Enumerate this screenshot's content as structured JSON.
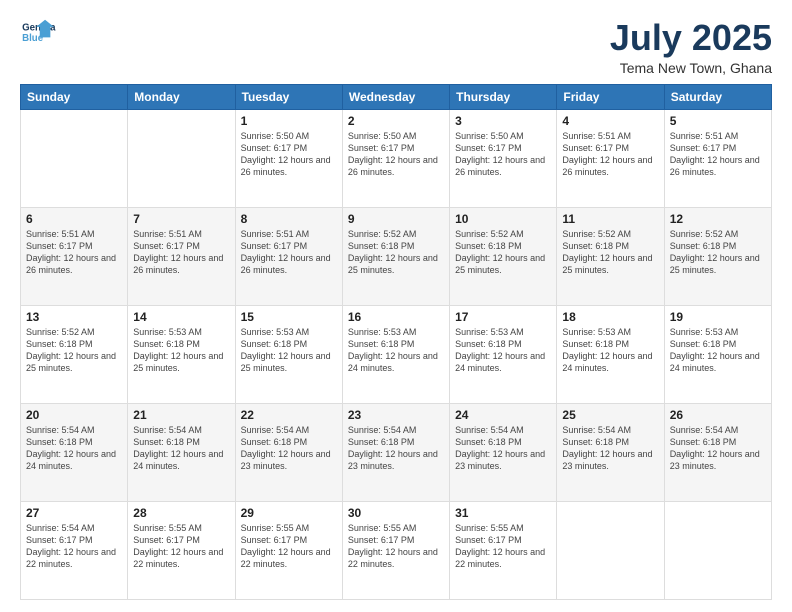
{
  "logo": {
    "line1": "General",
    "line2": "Blue"
  },
  "title": "July 2025",
  "subtitle": "Tema New Town, Ghana",
  "days_header": [
    "Sunday",
    "Monday",
    "Tuesday",
    "Wednesday",
    "Thursday",
    "Friday",
    "Saturday"
  ],
  "weeks": [
    [
      {
        "day": "",
        "info": ""
      },
      {
        "day": "",
        "info": ""
      },
      {
        "day": "1",
        "info": "Sunrise: 5:50 AM\nSunset: 6:17 PM\nDaylight: 12 hours\nand 26 minutes."
      },
      {
        "day": "2",
        "info": "Sunrise: 5:50 AM\nSunset: 6:17 PM\nDaylight: 12 hours\nand 26 minutes."
      },
      {
        "day": "3",
        "info": "Sunrise: 5:50 AM\nSunset: 6:17 PM\nDaylight: 12 hours\nand 26 minutes."
      },
      {
        "day": "4",
        "info": "Sunrise: 5:51 AM\nSunset: 6:17 PM\nDaylight: 12 hours\nand 26 minutes."
      },
      {
        "day": "5",
        "info": "Sunrise: 5:51 AM\nSunset: 6:17 PM\nDaylight: 12 hours\nand 26 minutes."
      }
    ],
    [
      {
        "day": "6",
        "info": "Sunrise: 5:51 AM\nSunset: 6:17 PM\nDaylight: 12 hours\nand 26 minutes."
      },
      {
        "day": "7",
        "info": "Sunrise: 5:51 AM\nSunset: 6:17 PM\nDaylight: 12 hours\nand 26 minutes."
      },
      {
        "day": "8",
        "info": "Sunrise: 5:51 AM\nSunset: 6:17 PM\nDaylight: 12 hours\nand 26 minutes."
      },
      {
        "day": "9",
        "info": "Sunrise: 5:52 AM\nSunset: 6:18 PM\nDaylight: 12 hours\nand 25 minutes."
      },
      {
        "day": "10",
        "info": "Sunrise: 5:52 AM\nSunset: 6:18 PM\nDaylight: 12 hours\nand 25 minutes."
      },
      {
        "day": "11",
        "info": "Sunrise: 5:52 AM\nSunset: 6:18 PM\nDaylight: 12 hours\nand 25 minutes."
      },
      {
        "day": "12",
        "info": "Sunrise: 5:52 AM\nSunset: 6:18 PM\nDaylight: 12 hours\nand 25 minutes."
      }
    ],
    [
      {
        "day": "13",
        "info": "Sunrise: 5:52 AM\nSunset: 6:18 PM\nDaylight: 12 hours\nand 25 minutes."
      },
      {
        "day": "14",
        "info": "Sunrise: 5:53 AM\nSunset: 6:18 PM\nDaylight: 12 hours\nand 25 minutes."
      },
      {
        "day": "15",
        "info": "Sunrise: 5:53 AM\nSunset: 6:18 PM\nDaylight: 12 hours\nand 25 minutes."
      },
      {
        "day": "16",
        "info": "Sunrise: 5:53 AM\nSunset: 6:18 PM\nDaylight: 12 hours\nand 24 minutes."
      },
      {
        "day": "17",
        "info": "Sunrise: 5:53 AM\nSunset: 6:18 PM\nDaylight: 12 hours\nand 24 minutes."
      },
      {
        "day": "18",
        "info": "Sunrise: 5:53 AM\nSunset: 6:18 PM\nDaylight: 12 hours\nand 24 minutes."
      },
      {
        "day": "19",
        "info": "Sunrise: 5:53 AM\nSunset: 6:18 PM\nDaylight: 12 hours\nand 24 minutes."
      }
    ],
    [
      {
        "day": "20",
        "info": "Sunrise: 5:54 AM\nSunset: 6:18 PM\nDaylight: 12 hours\nand 24 minutes."
      },
      {
        "day": "21",
        "info": "Sunrise: 5:54 AM\nSunset: 6:18 PM\nDaylight: 12 hours\nand 24 minutes."
      },
      {
        "day": "22",
        "info": "Sunrise: 5:54 AM\nSunset: 6:18 PM\nDaylight: 12 hours\nand 23 minutes."
      },
      {
        "day": "23",
        "info": "Sunrise: 5:54 AM\nSunset: 6:18 PM\nDaylight: 12 hours\nand 23 minutes."
      },
      {
        "day": "24",
        "info": "Sunrise: 5:54 AM\nSunset: 6:18 PM\nDaylight: 12 hours\nand 23 minutes."
      },
      {
        "day": "25",
        "info": "Sunrise: 5:54 AM\nSunset: 6:18 PM\nDaylight: 12 hours\nand 23 minutes."
      },
      {
        "day": "26",
        "info": "Sunrise: 5:54 AM\nSunset: 6:18 PM\nDaylight: 12 hours\nand 23 minutes."
      }
    ],
    [
      {
        "day": "27",
        "info": "Sunrise: 5:54 AM\nSunset: 6:17 PM\nDaylight: 12 hours\nand 22 minutes."
      },
      {
        "day": "28",
        "info": "Sunrise: 5:55 AM\nSunset: 6:17 PM\nDaylight: 12 hours\nand 22 minutes."
      },
      {
        "day": "29",
        "info": "Sunrise: 5:55 AM\nSunset: 6:17 PM\nDaylight: 12 hours\nand 22 minutes."
      },
      {
        "day": "30",
        "info": "Sunrise: 5:55 AM\nSunset: 6:17 PM\nDaylight: 12 hours\nand 22 minutes."
      },
      {
        "day": "31",
        "info": "Sunrise: 5:55 AM\nSunset: 6:17 PM\nDaylight: 12 hours\nand 22 minutes."
      },
      {
        "day": "",
        "info": ""
      },
      {
        "day": "",
        "info": ""
      }
    ]
  ]
}
